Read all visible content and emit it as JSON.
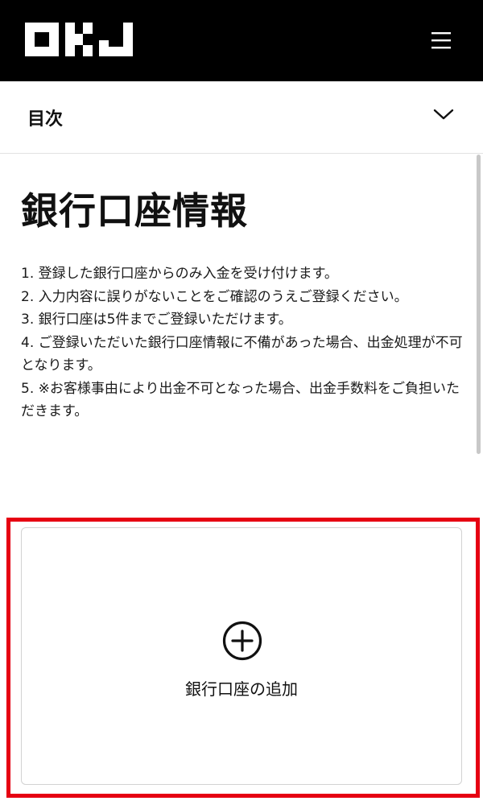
{
  "header": {
    "logo_text": "OKJ",
    "menu_icon": "hamburger-menu-icon"
  },
  "toc": {
    "label": "目次",
    "toggle_icon": "chevron-down-icon"
  },
  "page": {
    "title": "銀行口座情報"
  },
  "notes": [
    "1. 登録した銀行口座からのみ入金を受け付けます。",
    "2. 入力内容に誤りがないことをご確認のうえご登録ください。",
    "3. 銀行口座は5件までご登録いただけます。",
    "4. ご登録いただいた銀行口座情報に不備があった場合、出金処理が不可となります。",
    "5. ※お客様事由により出金不可となった場合、出金手数料をご負担いただきます。"
  ],
  "add_account": {
    "label": "銀行口座の追加",
    "icon": "plus-circle-icon"
  },
  "colors": {
    "header_bg": "#000000",
    "highlight_border": "#e60012",
    "card_border": "#d2d2d2"
  }
}
